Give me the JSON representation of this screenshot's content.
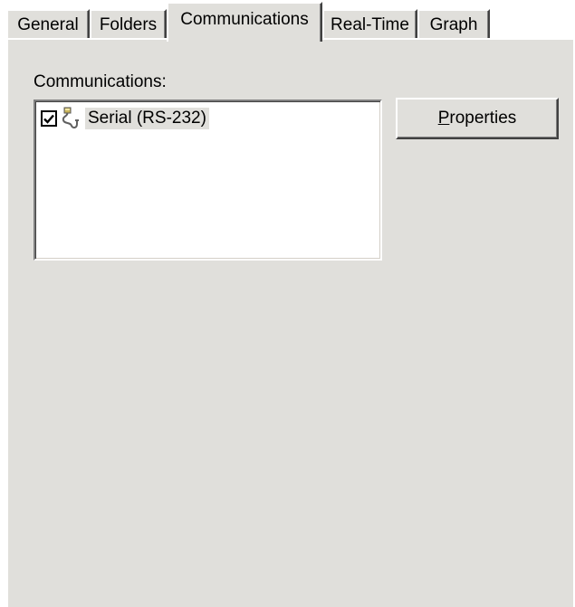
{
  "tabs": [
    {
      "label": "General"
    },
    {
      "label": "Folders"
    },
    {
      "label": "Communications"
    },
    {
      "label": "Real-Time"
    },
    {
      "label": "Graph"
    }
  ],
  "active_tab": "Communications",
  "communications": {
    "label": "Communications:",
    "items": [
      {
        "label": "Serial (RS-232)",
        "checked": true,
        "icon": "serial-cable-icon"
      }
    ],
    "properties_button": {
      "accelerator": "P",
      "rest": "roperties"
    }
  }
}
